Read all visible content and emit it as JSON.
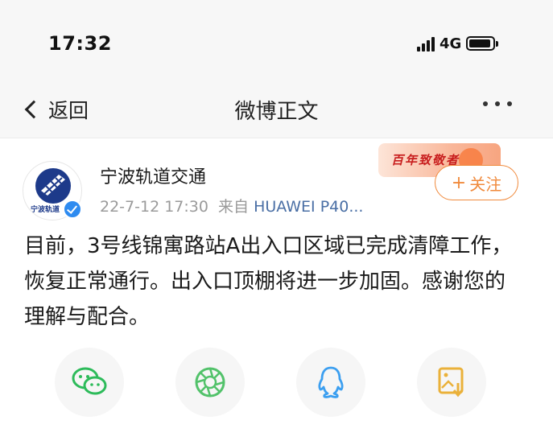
{
  "status_bar": {
    "time": "17:32",
    "network": "4G",
    "battery_level": 0.9
  },
  "nav": {
    "back_label": "返回",
    "title": "微博正文"
  },
  "author": {
    "name": "宁波轨道交通",
    "avatar_caption": "宁波轨道",
    "timestamp": "22-7-12 17:30",
    "source_prefix": "来自",
    "source": "HUAWEI P40..."
  },
  "banner": {
    "text": "百年致敬者"
  },
  "follow": {
    "label": "关注"
  },
  "post": {
    "text": "目前，3号线锦寓路站A出入口区域已完成清障工作，恢复正常通行。出入口顶棚将进一步加固。感谢您的理解与配合。"
  },
  "share": {
    "colors": {
      "wechat": "#2dbb5a",
      "moments": "#52c26a",
      "qq": "#3c9ff0",
      "save_image": "#eab13a"
    },
    "icons": [
      "wechat-icon",
      "moments-icon",
      "qq-icon",
      "save-image-icon"
    ]
  }
}
